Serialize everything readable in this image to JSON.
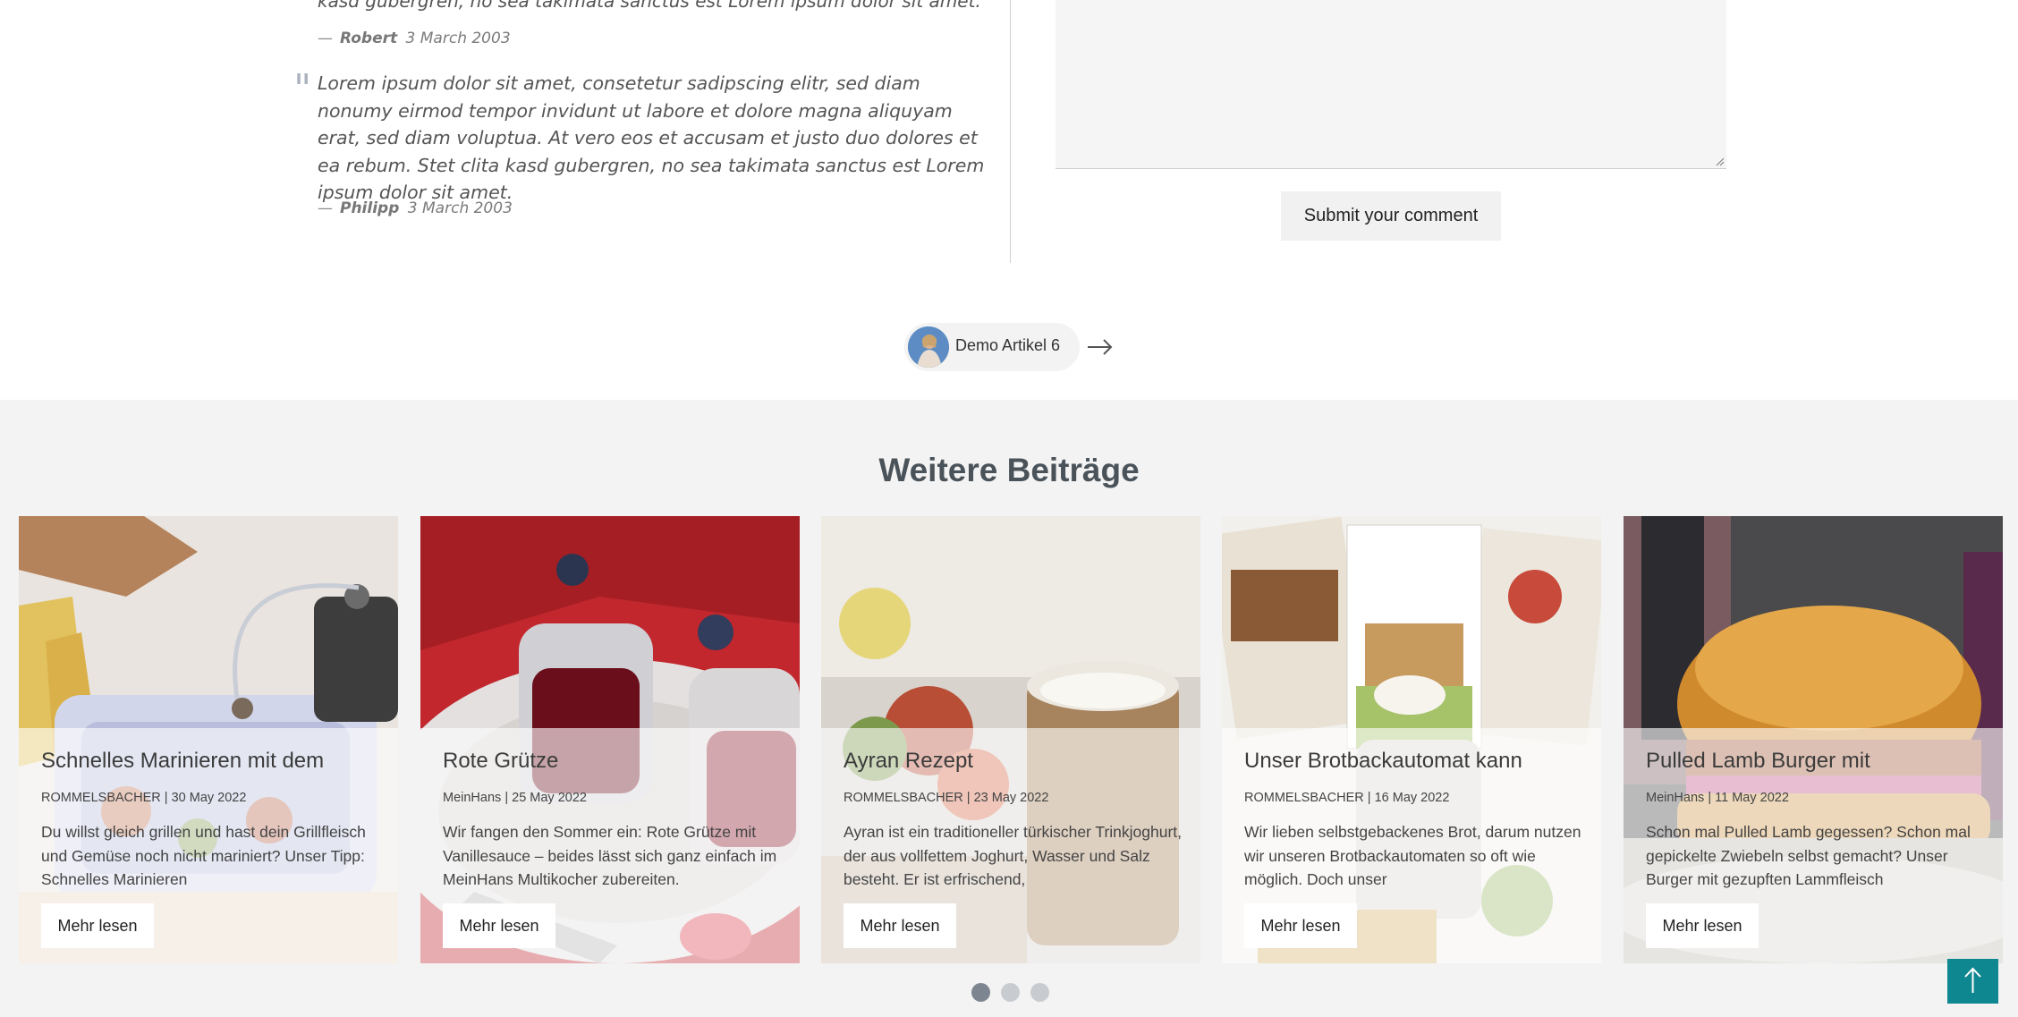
{
  "comments": {
    "fragment_text": "kasd gubergren, no sea takimata sanctus est Lorem ipsum dolor sit amet.",
    "first": {
      "author": "Robert",
      "date": "3 March 2003",
      "dash": "—"
    },
    "second": {
      "quote_glyph": "\"",
      "text": "Lorem ipsum dolor sit amet, consetetur sadipscing elitr, sed diam nonumy eirmod tempor invidunt ut labore et dolore magna aliquyam erat, sed diam voluptua. At vero eos et accusam et justo duo dolores et ea rebum. Stet clita kasd gubergren, no sea takimata sanctus est Lorem ipsum dolor sit amet.",
      "author": "Philipp",
      "date": "3 March 2003",
      "dash": "—"
    }
  },
  "comment_form": {
    "submit_label": "Submit your comment"
  },
  "post_nav": {
    "next_label": "Demo Artikel 6",
    "arrow_icon": "arrow-right-icon"
  },
  "more_posts": {
    "title": "Weitere Beiträge",
    "cards": [
      {
        "title": "Schnelles Marinieren mit dem",
        "author": "ROMMELSBACHER",
        "sep": "|",
        "date": "30 May 2022",
        "excerpt": "Du willst gleich grillen und hast dein Grillfleisch und Gemüse noch nicht mariniert? Unser Tipp: Schnelles Marinieren",
        "button": "Mehr lesen"
      },
      {
        "title": "Rote Grütze",
        "author": "MeinHans",
        "sep": "|",
        "date": "25 May 2022",
        "excerpt": "Wir fangen den Sommer ein: Rote Grütze mit Vanillesauce – beides lässt sich ganz einfach im MeinHans Multikocher zubereiten.",
        "button": "Mehr lesen"
      },
      {
        "title": "Ayran Rezept",
        "author": "ROMMELSBACHER",
        "sep": "|",
        "date": "23 May 2022",
        "excerpt": "Ayran ist ein traditioneller türkischer Trinkjoghurt, der aus vollfettem Joghurt, Wasser und Salz besteht. Er ist erfrischend,",
        "button": "Mehr lesen"
      },
      {
        "title": "Unser Brotbackautomat kann",
        "author": "ROMMELSBACHER",
        "sep": "|",
        "date": "16 May 2022",
        "excerpt": "Wir lieben selbstgebackenes Brot, darum nutzen wir unseren Brotbackautomaten so oft wie möglich. Doch unser",
        "button": "Mehr lesen"
      },
      {
        "title": "Pulled Lamb Burger mit",
        "author": "MeinHans",
        "sep": "|",
        "date": "11 May 2022",
        "excerpt": "Schon mal Pulled Lamb gegessen? Schon mal gepickelte Zwiebeln selbst gemacht? Unser Burger mit gezupften Lammfleisch",
        "button": "Mehr lesen"
      }
    ],
    "carousel_pages": 3,
    "carousel_active": 1
  },
  "scroll_top_icon": "arrow-up-icon"
}
